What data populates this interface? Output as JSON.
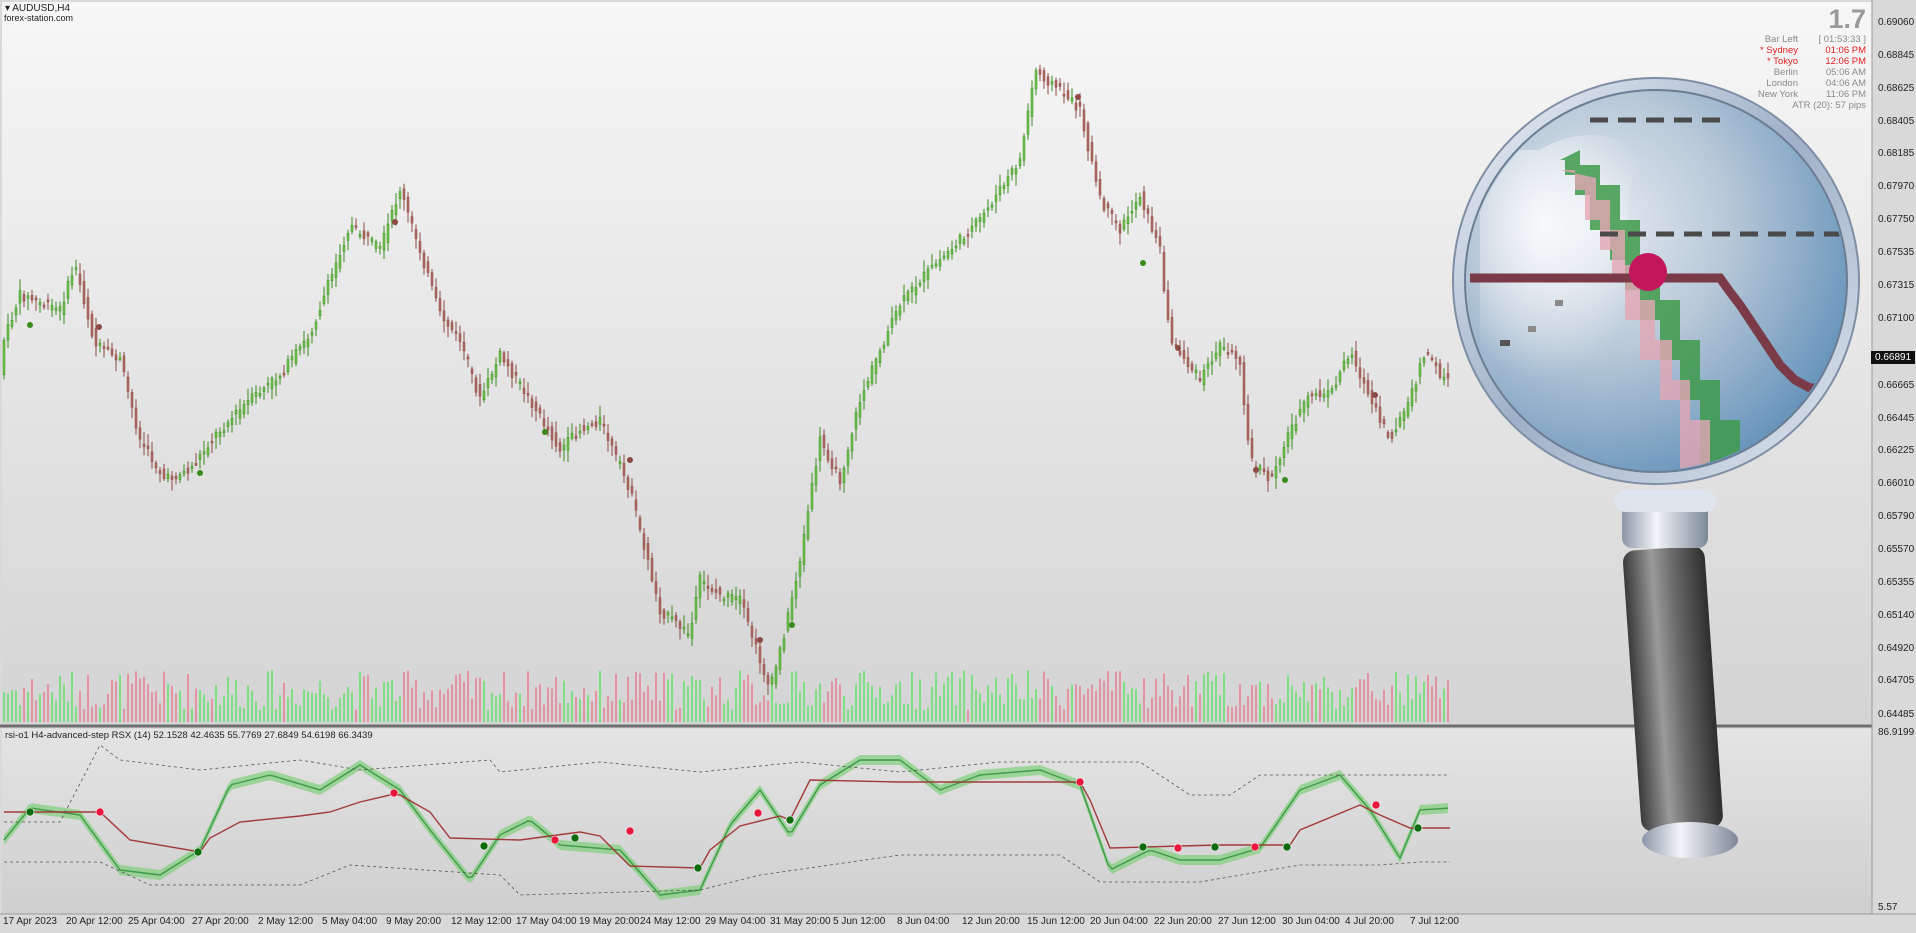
{
  "chart": {
    "symbol_title": "AUDUSD,H4",
    "watermark": "forex-station.com",
    "current_price": "0.66891",
    "price_axis": [
      "0.69060",
      "0.68845",
      "0.68625",
      "0.68405",
      "0.68185",
      "0.67970",
      "0.67750",
      "0.67535",
      "0.67315",
      "0.67100",
      "0.66891",
      "0.66665",
      "0.66445",
      "0.66225",
      "0.66010",
      "0.65790",
      "0.65570",
      "0.65355",
      "0.65140",
      "0.64920",
      "0.64705",
      "0.64485"
    ],
    "indicator_label": "rsi-o1 H4-advanced-step RSX (14) 52.1528 42.4635 55.7769 27.6849 54.6198 66.3439",
    "indicator_scale": [
      "86.9199",
      "5.57"
    ],
    "time_axis": [
      "17 Apr 2023",
      "20 Apr 12:00",
      "25 Apr 04:00",
      "27 Apr 20:00",
      "2 May 12:00",
      "5 May 04:00",
      "9 May 20:00",
      "12 May 12:00",
      "17 May 04:00",
      "19 May 20:00",
      "24 May 12:00",
      "29 May 04:00",
      "31 May 20:00",
      "5 Jun 12:00",
      "8 Jun 04:00",
      "12 Jun 20:00",
      "15 Jun 12:00",
      "20 Jun 04:00",
      "22 Jun 20:00",
      "27 Jun 12:00",
      "30 Jun 04:00",
      "4 Jul 20:00",
      "7 Jul 12:00"
    ],
    "colors": {
      "bull": "#3a8a1e",
      "bear": "#8b4a44",
      "vol_bull": "#76e07c",
      "vol_bear": "#e58c9c",
      "rsx_band": "#7fcf7a",
      "rsx_band_bear": "#d89a9a",
      "signal_line": "#a23a3a",
      "dot_green": "#0d6b0d",
      "dot_red": "#e8163c"
    }
  },
  "info_panel": {
    "big_number": "1.7",
    "rows": [
      {
        "label": "Bar Left",
        "value": "[ 01:53:33 ]",
        "highlight": false
      },
      {
        "label": "* Sydney",
        "value": "01:06 PM",
        "highlight": true
      },
      {
        "label": "* Tokyo",
        "value": "12:06 PM",
        "highlight": true
      },
      {
        "label": "Berlin",
        "value": "05:06 AM",
        "highlight": false
      },
      {
        "label": "London",
        "value": "04:06 AM",
        "highlight": false
      },
      {
        "label": "New York",
        "value": "11:06 PM",
        "highlight": false
      },
      {
        "label": "ATR (20): 57 pips",
        "value": "",
        "highlight": false
      }
    ]
  },
  "magnifier": {
    "icon": "magnifying-glass-icon"
  }
}
